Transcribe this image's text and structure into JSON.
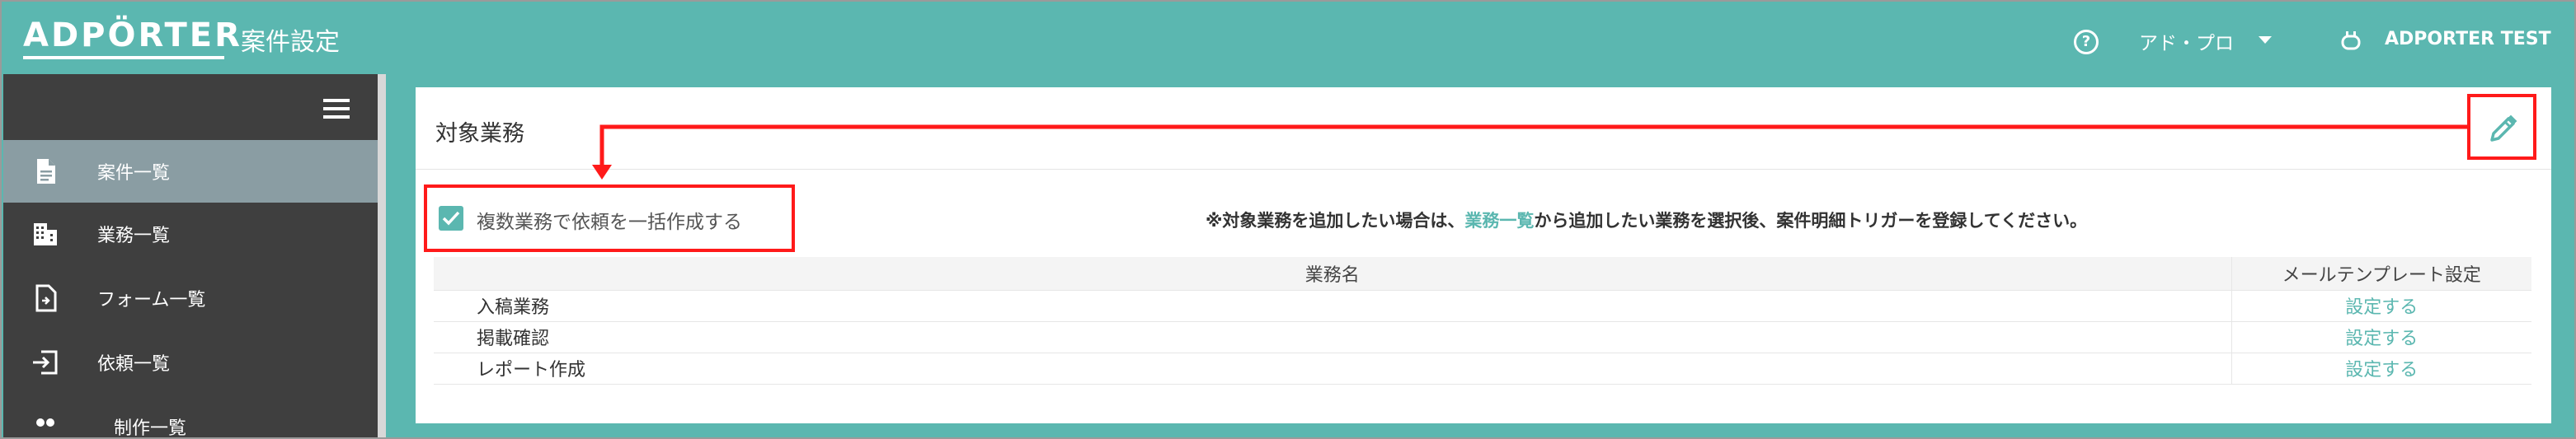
{
  "header": {
    "logo": "ADPÖRTER",
    "title": "案件設定",
    "help_icon": "help-icon",
    "org": "アド・プロ",
    "user": "ADPORTER TEST"
  },
  "sidebar": {
    "items": [
      {
        "label": "案件一覧",
        "icon": "document-icon",
        "active": true
      },
      {
        "label": "業務一覧",
        "icon": "building-icon",
        "active": false
      },
      {
        "label": "フォーム一覧",
        "icon": "form-icon",
        "active": false
      },
      {
        "label": "依頼一覧",
        "icon": "login-icon",
        "active": false
      },
      {
        "label": "制作一覧",
        "icon": "people-icon",
        "active": false
      }
    ]
  },
  "panel": {
    "title": "対象業務",
    "checkbox": {
      "label": "複数業務で依頼を一括作成する",
      "checked": true
    },
    "notice_prefix": "※対象業務を追加したい場合は、",
    "notice_link": "業務一覧",
    "notice_suffix": "から追加したい業務を選択後、案件明細トリガーを登録してください。",
    "table": {
      "headers": [
        "業務名",
        "メールテンプレート設定"
      ],
      "rows": [
        {
          "name": "入稿業務",
          "action": "設定する"
        },
        {
          "name": "掲載確認",
          "action": "設定する"
        },
        {
          "name": "レポート作成",
          "action": "設定する"
        }
      ]
    }
  },
  "colors": {
    "accent": "#5bb7b0",
    "sidebar": "#3f3f3f",
    "sidebar_active": "#8a9da3",
    "highlight": "#ff1a1a"
  }
}
